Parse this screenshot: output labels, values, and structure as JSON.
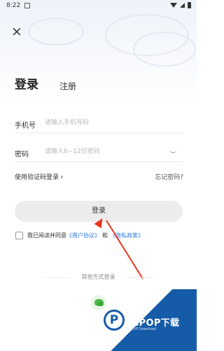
{
  "status_bar": {
    "time": "8:22"
  },
  "tabs": {
    "login": "登录",
    "register": "注册"
  },
  "form": {
    "phone_label": "手机号",
    "phone_placeholder": "请输入手机号码",
    "password_label": "密码",
    "password_placeholder": "请输入6~12位密码"
  },
  "links": {
    "sms_login": "使用验证码登录",
    "sms_chevron": "›",
    "forgot_password": "忘记密码?"
  },
  "login_button": "登录",
  "agreement": {
    "prefix": "我已阅读并同意",
    "user_agreement": "《用户协议》",
    "and": "和",
    "privacy_policy": "《隐私政策》"
  },
  "other_login": {
    "title": "其他方式登录"
  },
  "watermark": {
    "logo": "P",
    "text": "PCPOP下载",
    "sub": "PCPOP Download"
  },
  "colors": {
    "link": "#2c7be5",
    "arrow": "#e8361f",
    "watermark": "#165ba8"
  }
}
